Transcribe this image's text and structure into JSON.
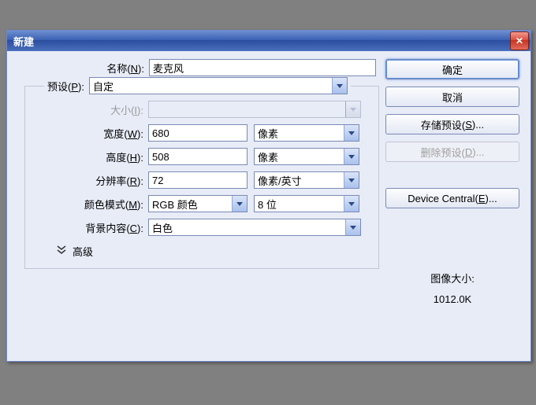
{
  "window": {
    "title": "新建"
  },
  "fields": {
    "name_label_pre": "名称(",
    "name_hotkey": "N",
    "name_label_post": "):",
    "name_value": "麦克风",
    "preset_label_pre": "预设(",
    "preset_hotkey": "P",
    "preset_label_post": "):",
    "preset_value": "自定",
    "size_label_pre": "大小(",
    "size_hotkey": "I",
    "size_label_post": "):",
    "size_value": "",
    "width_label_pre": "宽度(",
    "width_hotkey": "W",
    "width_label_post": "):",
    "width_value": "680",
    "width_unit": "像素",
    "height_label_pre": "高度(",
    "height_hotkey": "H",
    "height_label_post": "):",
    "height_value": "508",
    "height_unit": "像素",
    "res_label_pre": "分辨率(",
    "res_hotkey": "R",
    "res_label_post": "):",
    "res_value": "72",
    "res_unit": "像素/英寸",
    "mode_label_pre": "颜色模式(",
    "mode_hotkey": "M",
    "mode_label_post": "):",
    "mode_value": "RGB 颜色",
    "depth_value": "8 位",
    "bg_label_pre": "背景内容(",
    "bg_hotkey": "C",
    "bg_label_post": "):",
    "bg_value": "白色",
    "advanced_label": "高级"
  },
  "buttons": {
    "ok": "确定",
    "cancel": "取消",
    "save_preset_pre": "存储预设(",
    "save_preset_hotkey": "S",
    "save_preset_post": ")...",
    "delete_preset_pre": "删除预设(",
    "delete_preset_hotkey": "D",
    "delete_preset_post": ")...",
    "device_central_pre": "Device Central(",
    "device_central_hotkey": "E",
    "device_central_post": ")..."
  },
  "image_size": {
    "label": "图像大小:",
    "value": "1012.0K"
  }
}
